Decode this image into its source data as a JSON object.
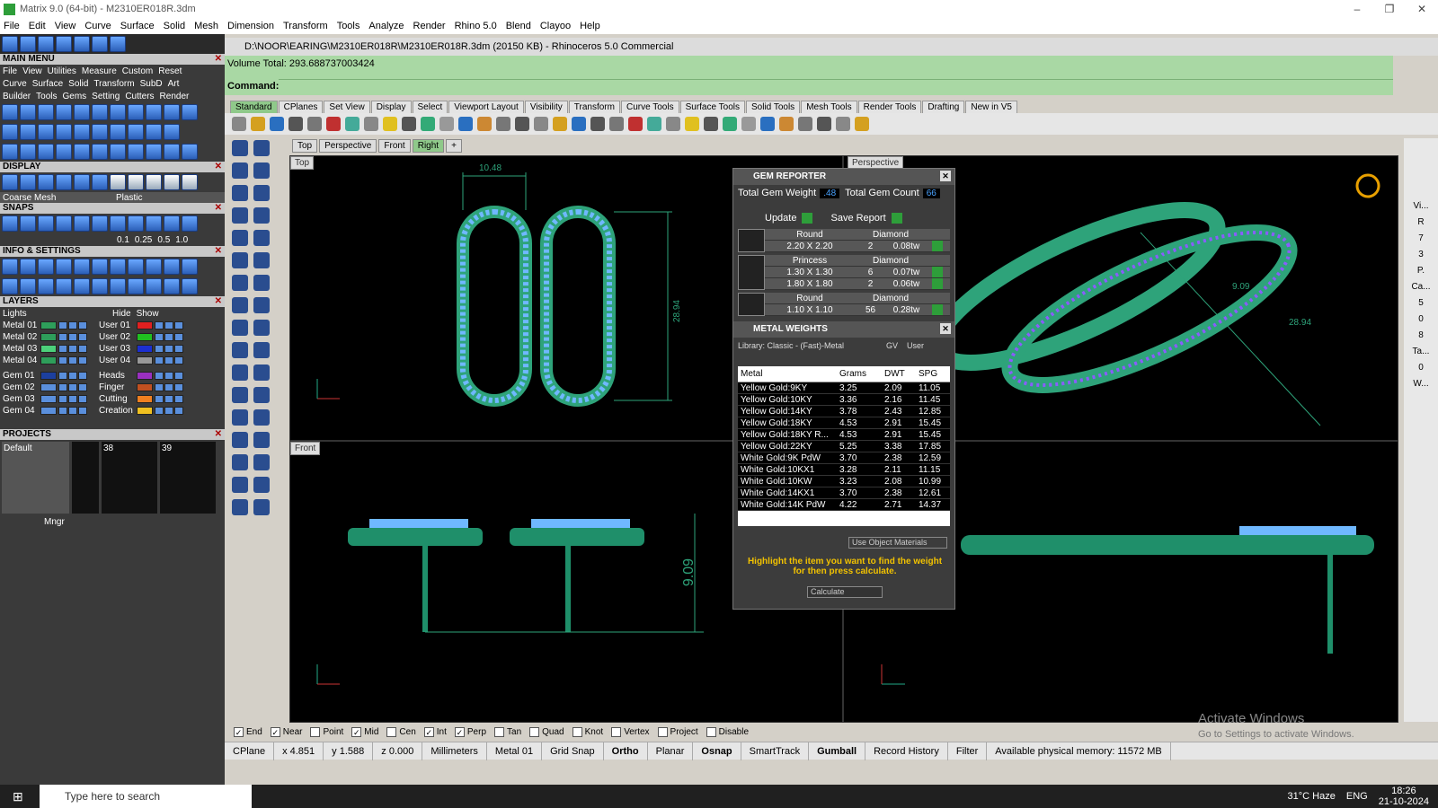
{
  "window": {
    "title": "Matrix 9.0 (64-bit) - M2310ER018R.3dm",
    "controls": [
      "–",
      "❐",
      "✕"
    ]
  },
  "menubar": [
    "File",
    "Edit",
    "View",
    "Curve",
    "Surface",
    "Solid",
    "Mesh",
    "Dimension",
    "Transform",
    "Tools",
    "Analyze",
    "Render",
    "Rhino 5.0",
    "Blend",
    "Clayoo",
    "Help"
  ],
  "left": {
    "main_menu_title": "MAIN MENU",
    "main_menu_row1": [
      "File",
      "View",
      "Utilities",
      "Measure",
      "Custom",
      "Reset"
    ],
    "main_menu_row2": [
      "Curve",
      "Surface",
      "Solid",
      "Transform",
      "SubD",
      "Art"
    ],
    "main_menu_row3": [
      "Builder",
      "Tools",
      "Gems",
      "Setting",
      "Cutters",
      "Render"
    ],
    "display_title": "DISPLAY",
    "display_mesh": "Coarse Mesh",
    "display_material": "Plastic",
    "snaps_title": "SNAPS",
    "snap_values": [
      "0.1",
      "0.25",
      "0.5",
      "1.0"
    ],
    "info_title": "INFO & SETTINGS",
    "layers_title": "LAYERS",
    "lights": "Lights",
    "hide": "Hide",
    "show": "Show",
    "layers_left": [
      {
        "name": "Metal 01",
        "color": "#2e9e5a"
      },
      {
        "name": "Metal 02",
        "color": "#2e9e5a"
      },
      {
        "name": "Metal 03",
        "color": "#4cd07a"
      },
      {
        "name": "Metal 04",
        "color": "#2e9e5a"
      },
      {
        "name": "Gem 01",
        "color": "#1c3f9e"
      },
      {
        "name": "Gem 02",
        "color": "#5a8fdc"
      },
      {
        "name": "Gem 03",
        "color": "#5a8fdc"
      },
      {
        "name": "Gem 04",
        "color": "#5a8fdc"
      }
    ],
    "layers_right": [
      {
        "name": "User 01",
        "color": "#e02020"
      },
      {
        "name": "User 02",
        "color": "#20c020"
      },
      {
        "name": "User 03",
        "color": "#1c2fd0"
      },
      {
        "name": "User 04",
        "color": "#999999"
      },
      {
        "name": "Heads",
        "color": "#9a30c0"
      },
      {
        "name": "Finger",
        "color": "#c05020"
      },
      {
        "name": "Cutting",
        "color": "#f08020"
      },
      {
        "name": "Creation",
        "color": "#f0c020"
      }
    ],
    "projects_title": "PROJECTS",
    "project_default": "Default",
    "project_nums": [
      "38",
      "39"
    ],
    "mngr": "Mngr"
  },
  "doc": {
    "path": "D:\\NOOR\\EARING\\M2310ER018R\\M2310ER018R.3dm (20150 KB) - Rhinoceros 5.0 Commercial",
    "volume": "Volume Total: 293.688737003424",
    "command": "Command:"
  },
  "tabs": [
    "Standard",
    "CPlanes",
    "Set View",
    "Display",
    "Select",
    "Viewport Layout",
    "Visibility",
    "Transform",
    "Curve Tools",
    "Surface Tools",
    "Solid Tools",
    "Mesh Tools",
    "Render Tools",
    "Drafting",
    "New in V5"
  ],
  "viewtabs": [
    "Top",
    "Perspective",
    "Front",
    "Right",
    "+"
  ],
  "viewports": {
    "top": {
      "name": "Top",
      "dim_w": "10.48",
      "dim_h": "28.94"
    },
    "perspective": {
      "name": "Perspective",
      "dim1": "9.09",
      "dim2": "28.94"
    },
    "front": {
      "name": "Front",
      "dim": "9.09"
    }
  },
  "gem_reporter": {
    "title": "GEM REPORTER",
    "total_weight_label": "Total Gem Weight",
    "total_weight": ".48",
    "total_count_label": "Total Gem Count",
    "total_count": "66",
    "update": "Update",
    "save_report": "Save Report",
    "gems": [
      {
        "cut": "Round",
        "type": "Diamond",
        "rows": [
          [
            "2.20 X 2.20",
            "2",
            "0.08tw"
          ]
        ]
      },
      {
        "cut": "Princess",
        "type": "Diamond",
        "rows": [
          [
            "1.30 X 1.30",
            "6",
            "0.07tw"
          ],
          [
            "1.80 X 1.80",
            "2",
            "0.06tw"
          ]
        ]
      },
      {
        "cut": "Round",
        "type": "Diamond",
        "rows": [
          [
            "1.10 X 1.10",
            "56",
            "0.28tw"
          ]
        ]
      }
    ],
    "mw_title": "METAL WEIGHTS",
    "library": "Library: Classic - (Fast)-Metal",
    "gv": "GV",
    "user": "User",
    "headers": [
      "Metal",
      "Grams",
      "DWT",
      "SPG"
    ],
    "metals": [
      [
        "Yellow Gold:9KY",
        "3.25",
        "2.09",
        "11.05"
      ],
      [
        "Yellow Gold:10KY",
        "3.36",
        "2.16",
        "11.45"
      ],
      [
        "Yellow Gold:14KY",
        "3.78",
        "2.43",
        "12.85"
      ],
      [
        "Yellow Gold:18KY",
        "4.53",
        "2.91",
        "15.45"
      ],
      [
        "Yellow Gold:18KY R...",
        "4.53",
        "2.91",
        "15.45"
      ],
      [
        "Yellow Gold:22KY",
        "5.25",
        "3.38",
        "17.85"
      ],
      [
        "White Gold:9K PdW",
        "3.70",
        "2.38",
        "12.59"
      ],
      [
        "White Gold:10KX1",
        "3.28",
        "2.11",
        "11.15"
      ],
      [
        "White Gold:10KW",
        "3.23",
        "2.08",
        "10.99"
      ],
      [
        "White Gold:14KX1",
        "3.70",
        "2.38",
        "12.61"
      ],
      [
        "White Gold:14K PdW",
        "4.22",
        "2.71",
        "14.37"
      ]
    ],
    "use_obj": "Use Object Materials",
    "hint": "Highlight the item you want to find the weight for then press calculate.",
    "calculate": "Calculate"
  },
  "snaps": [
    {
      "label": "End",
      "checked": true
    },
    {
      "label": "Near",
      "checked": true
    },
    {
      "label": "Point",
      "checked": false
    },
    {
      "label": "Mid",
      "checked": true
    },
    {
      "label": "Cen",
      "checked": false
    },
    {
      "label": "Int",
      "checked": true
    },
    {
      "label": "Perp",
      "checked": true
    },
    {
      "label": "Tan",
      "checked": false
    },
    {
      "label": "Quad",
      "checked": false
    },
    {
      "label": "Knot",
      "checked": false
    },
    {
      "label": "Vertex",
      "checked": false
    },
    {
      "label": "Project",
      "checked": false
    },
    {
      "label": "Disable",
      "checked": false
    }
  ],
  "status": {
    "cplane": "CPlane",
    "x": "x 4.851",
    "y": "y 1.588",
    "z": "z 0.000",
    "units": "Millimeters",
    "layer": "Metal 01",
    "grid": "Grid Snap",
    "ortho": "Ortho",
    "planar": "Planar",
    "osnap": "Osnap",
    "smart": "SmartTrack",
    "gumball": "Gumball",
    "record": "Record History",
    "filter": "Filter",
    "memory": "Available physical memory: 11572 MB"
  },
  "right_strip": [
    "Vi...",
    "R",
    "7",
    "3",
    "P.",
    "Ca...",
    "5",
    "0",
    "8",
    "Ta...",
    "0",
    "W..."
  ],
  "watermark": {
    "title": "Activate Windows",
    "sub": "Go to Settings to activate Windows."
  },
  "taskbar": {
    "search": "Type here to search",
    "weather": "31°C  Haze",
    "lang": "ENG",
    "time": "18:26",
    "date": "21-10-2024"
  }
}
